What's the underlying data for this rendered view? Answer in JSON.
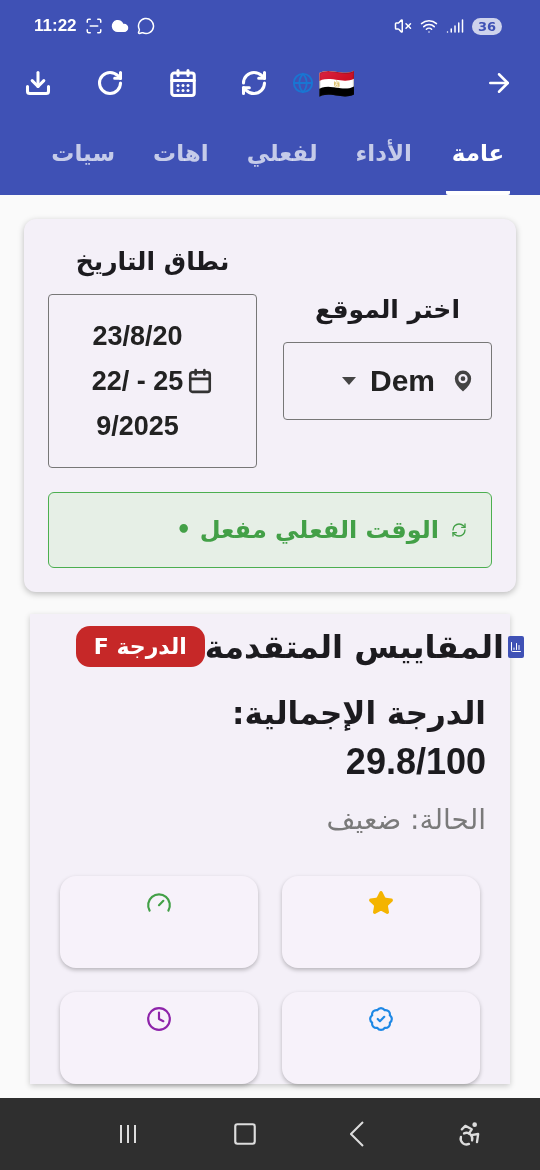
{
  "status_bar": {
    "time": "11:22",
    "battery": "36"
  },
  "toolbar": {
    "flag": "🇪🇬"
  },
  "tabs": [
    {
      "label": "عامة",
      "selected": true
    },
    {
      "label": "الأداء",
      "selected": false
    },
    {
      "label": "لفعلي",
      "selected": false
    },
    {
      "label": "اهات",
      "selected": false
    },
    {
      "label": "سيات",
      "selected": false
    }
  ],
  "filters": {
    "location_label": "اختر الموقع",
    "location_value": "Dem",
    "date_label": "نطاق التاريخ",
    "date_lines": [
      "23/8/20",
      "22/ - 25",
      "9/2025"
    ],
    "realtime": {
      "label": "الوقت الفعلي مفعل •",
      "on": true
    }
  },
  "metrics_card": {
    "title": "المقاييس المتقدمة",
    "grade_badge": "الدرجة F",
    "score_label": "الدرجة الإجمالية:",
    "score": "29.8/100",
    "status": "الحالة: ضعيف",
    "metrics": [
      {
        "kind": "star",
        "color": "#f4b400"
      },
      {
        "kind": "gauge",
        "color": "#43a047"
      },
      {
        "kind": "verified",
        "color": "#1e88e5"
      },
      {
        "kind": "clock",
        "color": "#8e24aa"
      }
    ]
  }
}
